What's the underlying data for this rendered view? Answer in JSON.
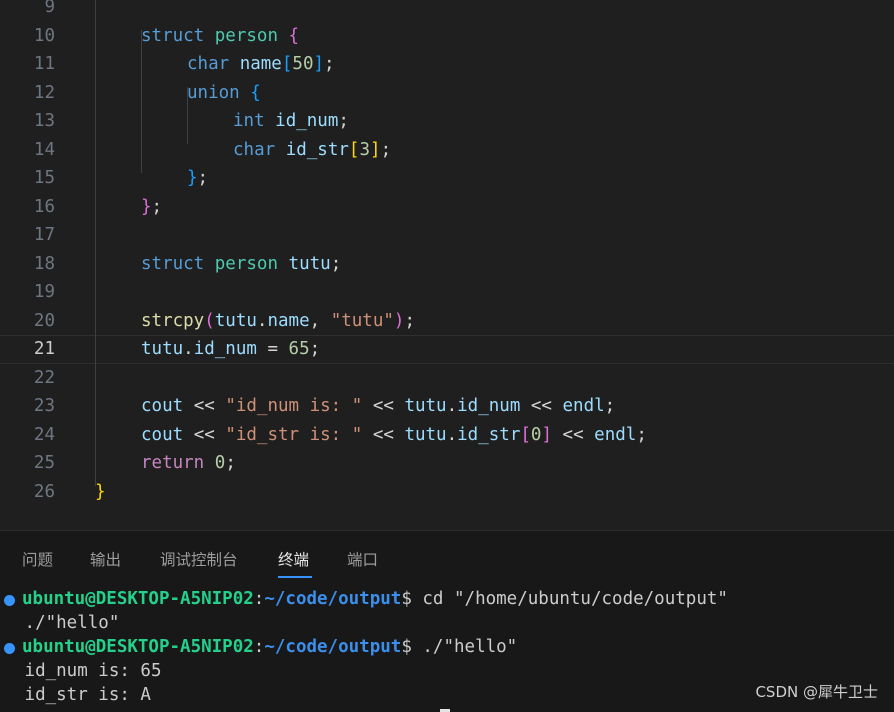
{
  "editor": {
    "line_numbers": [
      "9",
      "10",
      "11",
      "12",
      "13",
      "14",
      "15",
      "16",
      "17",
      "18",
      "19",
      "20",
      "21",
      "22",
      "23",
      "24",
      "25",
      "26"
    ],
    "current_line": "21",
    "lines": [
      [],
      [
        [
          "kw",
          "struct"
        ],
        [
          "pu",
          " "
        ],
        [
          "tp",
          "person"
        ],
        [
          "pu",
          " "
        ],
        [
          "br2",
          "{"
        ]
      ],
      [
        [
          "kw",
          "char"
        ],
        [
          "pu",
          " "
        ],
        [
          "nm",
          "name"
        ],
        [
          "br3",
          "["
        ],
        [
          "nu",
          "50"
        ],
        [
          "br3",
          "]"
        ],
        [
          "pu",
          ";"
        ]
      ],
      [
        [
          "kw",
          "union"
        ],
        [
          "pu",
          " "
        ],
        [
          "br3",
          "{"
        ]
      ],
      [
        [
          "kw",
          "int"
        ],
        [
          "pu",
          " "
        ],
        [
          "nm",
          "id_num"
        ],
        [
          "pu",
          ";"
        ]
      ],
      [
        [
          "kw",
          "char"
        ],
        [
          "pu",
          " "
        ],
        [
          "nm",
          "id_str"
        ],
        [
          "br1",
          "["
        ],
        [
          "nu",
          "3"
        ],
        [
          "br1",
          "]"
        ],
        [
          "pu",
          ";"
        ]
      ],
      [
        [
          "br3",
          "}"
        ],
        [
          "pu",
          ";"
        ]
      ],
      [
        [
          "br2",
          "}"
        ],
        [
          "pu",
          ";"
        ]
      ],
      [],
      [
        [
          "kw",
          "struct"
        ],
        [
          "pu",
          " "
        ],
        [
          "tp",
          "person"
        ],
        [
          "pu",
          " "
        ],
        [
          "nm",
          "tutu"
        ],
        [
          "pu",
          ";"
        ]
      ],
      [],
      [
        [
          "fn",
          "strcpy"
        ],
        [
          "br2",
          "("
        ],
        [
          "nm",
          "tutu"
        ],
        [
          "pu",
          "."
        ],
        [
          "nm",
          "name"
        ],
        [
          "pu",
          ", "
        ],
        [
          "st",
          "\"tutu\""
        ],
        [
          "br2",
          ")"
        ],
        [
          "pu",
          ";"
        ]
      ],
      [
        [
          "nm",
          "tutu"
        ],
        [
          "pu",
          "."
        ],
        [
          "nm",
          "id_num"
        ],
        [
          "pu",
          " = "
        ],
        [
          "nu",
          "65"
        ],
        [
          "pu",
          ";"
        ]
      ],
      [],
      [
        [
          "nm",
          "cout"
        ],
        [
          "pu",
          " << "
        ],
        [
          "st",
          "\"id_num is: \""
        ],
        [
          "pu",
          " << "
        ],
        [
          "nm",
          "tutu"
        ],
        [
          "pu",
          "."
        ],
        [
          "nm",
          "id_num"
        ],
        [
          "pu",
          " << "
        ],
        [
          "nm",
          "endl"
        ],
        [
          "pu",
          ";"
        ]
      ],
      [
        [
          "nm",
          "cout"
        ],
        [
          "pu",
          " << "
        ],
        [
          "st",
          "\"id_str is: \""
        ],
        [
          "pu",
          " << "
        ],
        [
          "nm",
          "tutu"
        ],
        [
          "pu",
          "."
        ],
        [
          "nm",
          "id_str"
        ],
        [
          "br2",
          "["
        ],
        [
          "nu",
          "0"
        ],
        [
          "br2",
          "]"
        ],
        [
          "pu",
          " << "
        ],
        [
          "nm",
          "endl"
        ],
        [
          "pu",
          ";"
        ]
      ],
      [
        [
          "ctl",
          "return"
        ],
        [
          "pu",
          " "
        ],
        [
          "nu",
          "0"
        ],
        [
          "pu",
          ";"
        ]
      ],
      [
        [
          "br1",
          "}"
        ]
      ]
    ],
    "indent_levels": [
      1,
      1,
      2,
      2,
      3,
      3,
      2,
      1,
      1,
      1,
      1,
      1,
      1,
      1,
      1,
      1,
      1,
      0
    ]
  },
  "panel": {
    "tabs": [
      {
        "label": "问题",
        "active": false
      },
      {
        "label": "输出",
        "active": false
      },
      {
        "label": "调试控制台",
        "active": false
      },
      {
        "label": "终端",
        "active": true
      },
      {
        "label": "端口",
        "active": false
      }
    ]
  },
  "terminal": {
    "lines": [
      {
        "dot": true,
        "user": "ubuntu@DESKTOP-A5NIP02",
        "sep": ":",
        "path": "~/code/output",
        "end": "$",
        "cmd": " cd \"/home/ubuntu/code/output\""
      },
      {
        "text": " ./\"hello\""
      },
      {
        "dot": true,
        "user": "ubuntu@DESKTOP-A5NIP02",
        "sep": ":",
        "path": "~/code/output",
        "end": "$",
        "cmd": " ./\"hello\""
      },
      {
        "text": " id_num is: 65"
      },
      {
        "text": " id_str is: A"
      }
    ]
  },
  "watermark": "CSDN @犀牛卫士",
  "colors": {
    "accent": "#3794ff",
    "prompt_user": "#23d18b",
    "prompt_path": "#3b8eea"
  }
}
